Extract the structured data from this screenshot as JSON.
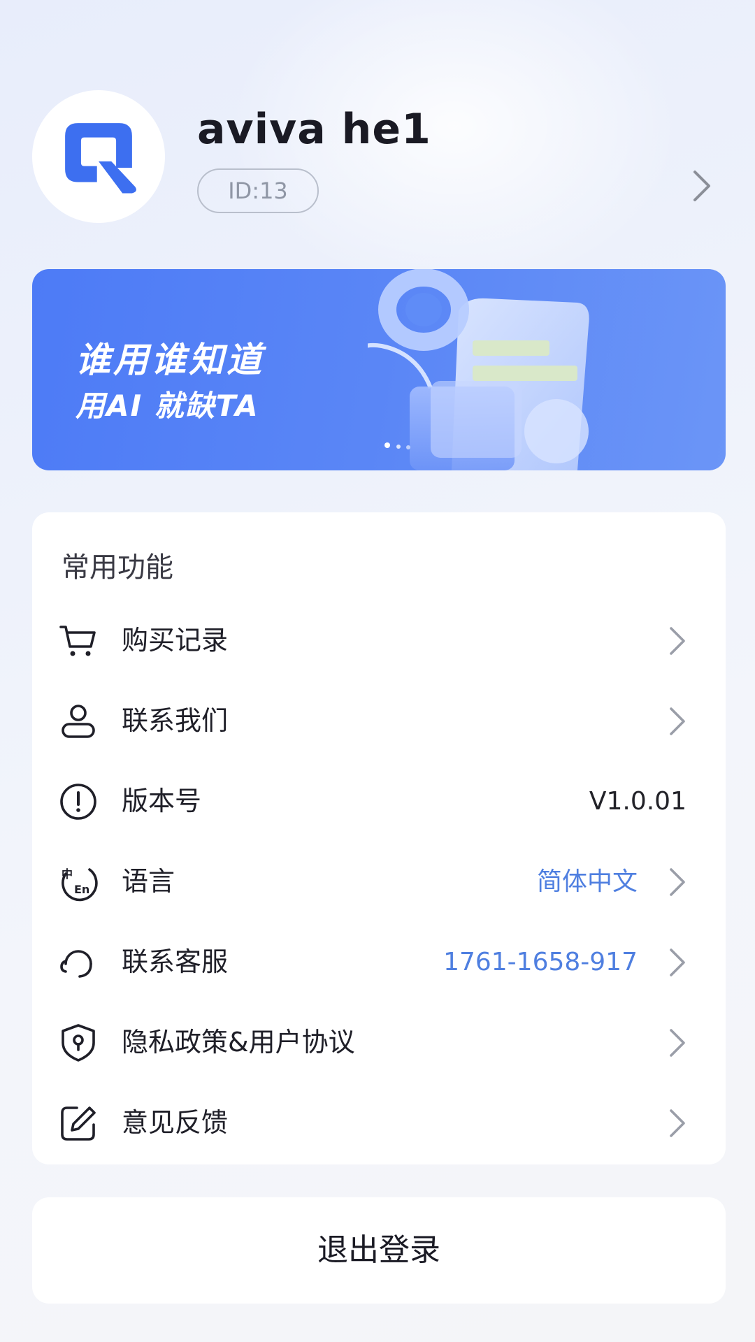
{
  "profile": {
    "username": "aviva he1",
    "id_label": "ID:13"
  },
  "banner": {
    "title": "谁用谁知道",
    "subtitle": "用AI 就缺TA"
  },
  "features": {
    "section_title": "常用功能",
    "items": [
      {
        "label": "购买记录",
        "icon": "cart-icon",
        "value": ""
      },
      {
        "label": "联系我们",
        "icon": "user-icon",
        "value": ""
      },
      {
        "label": "版本号",
        "icon": "info-icon",
        "value": "V1.0.01"
      },
      {
        "label": "语言",
        "icon": "language-icon",
        "value": "简体中文"
      },
      {
        "label": "联系客服",
        "icon": "headset-icon",
        "value": "1761-1658-917"
      },
      {
        "label": "隐私政策&用户协议",
        "icon": "shield-lock-icon",
        "value": ""
      },
      {
        "label": "意见反馈",
        "icon": "edit-icon",
        "value": ""
      }
    ]
  },
  "logout_label": "退出登录",
  "colors": {
    "accent": "#4f7fe0",
    "banner": "#5a86f6"
  }
}
